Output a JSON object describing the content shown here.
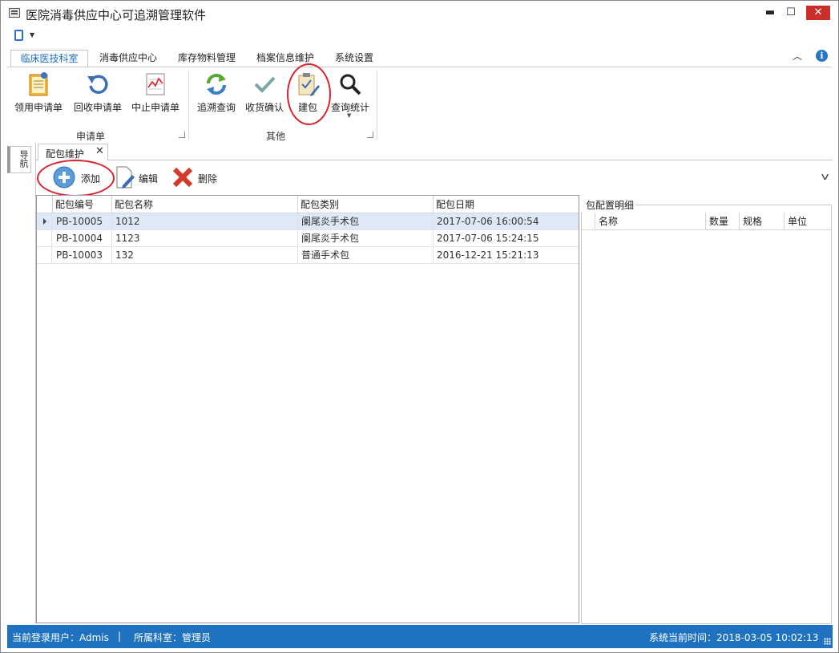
{
  "window": {
    "title": "医院消毒供应中心可追溯管理软件",
    "minimize": "▬",
    "maximize": "☐",
    "close": "✕"
  },
  "ribbon": {
    "tabs": [
      {
        "label": "临床医技科室",
        "active": true
      },
      {
        "label": "消毒供应中心",
        "active": false
      },
      {
        "label": "库存物料管理",
        "active": false
      },
      {
        "label": "档案信息维护",
        "active": false
      },
      {
        "label": "系统设置",
        "active": false
      }
    ],
    "collapse": "︿",
    "info": "i",
    "groups": [
      {
        "label": "申请单",
        "buttons": [
          {
            "label": "领用申请单",
            "icon": "clipboard-icon"
          },
          {
            "label": "回收申请单",
            "icon": "undo-icon"
          },
          {
            "label": "中止申请单",
            "icon": "chart-icon"
          }
        ]
      },
      {
        "label": "其他",
        "buttons": [
          {
            "label": "追溯查询",
            "icon": "refresh-icon"
          },
          {
            "label": "收货确认",
            "icon": "checkmark-icon"
          },
          {
            "label": "建包",
            "icon": "clipboard-edit-icon"
          },
          {
            "label": "查询统计",
            "icon": "search-icon"
          }
        ]
      }
    ]
  },
  "side_panel": {
    "tab_label": "导航"
  },
  "document_tab": {
    "label": "配包维护",
    "close": "✕"
  },
  "toolbar": {
    "add_label": "添加",
    "edit_label": "编辑",
    "delete_label": "删除"
  },
  "grid": {
    "columns": [
      "配包编号",
      "配包名称",
      "配包类别",
      "配包日期"
    ],
    "rows": [
      [
        "PB-10005",
        "1012",
        "阑尾炎手术包",
        "2017-07-06 16:00:54"
      ],
      [
        "PB-10004",
        "1123",
        "阑尾炎手术包",
        "2017-07-06 15:24:15"
      ],
      [
        "PB-10003",
        "132",
        "普通手术包",
        "2016-12-21 15:21:13"
      ]
    ],
    "selected_row": 0
  },
  "detail": {
    "title": "包配置明细",
    "columns": [
      "名称",
      "数量",
      "规格",
      "单位"
    ]
  },
  "status": {
    "user": "当前登录用户：Admis",
    "separator": "|",
    "department": "所属科室：管理员",
    "time": "系统当前时间：2018-03-05 10:02:13"
  },
  "colors": {
    "accent": "#1e72c0",
    "highlight_circle": "#d9232e",
    "selected_row": "#dde9f6"
  }
}
